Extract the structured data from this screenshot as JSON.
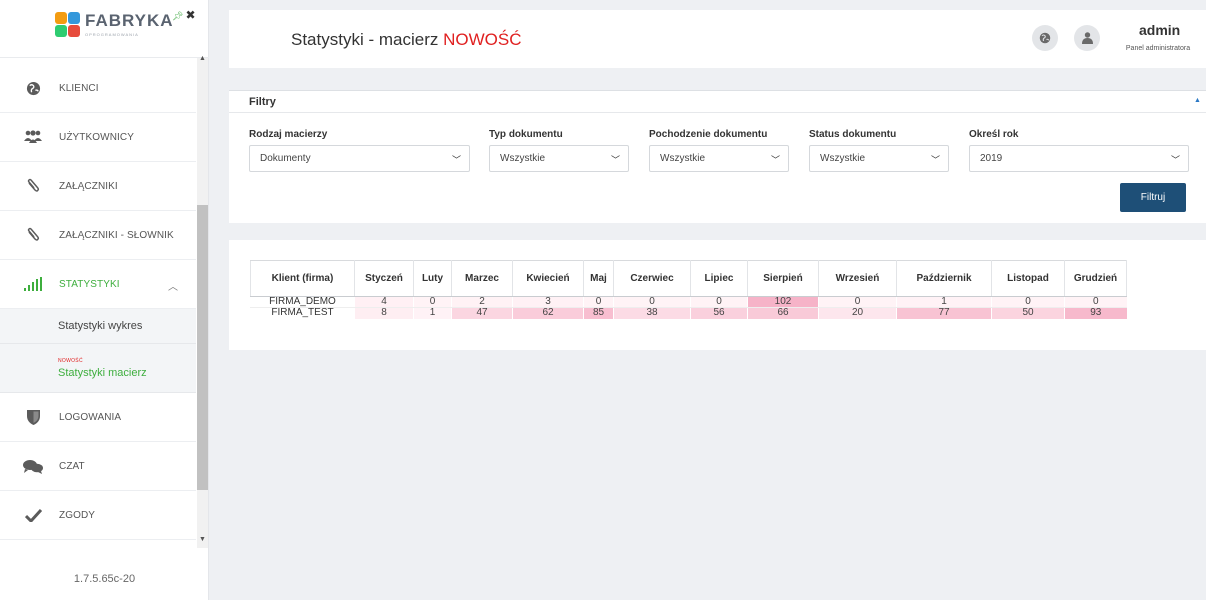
{
  "app": {
    "logo_text": "FABRYKA",
    "logo_sub": "OPROGRAMOWANIA",
    "version": "1.7.5.65c-20"
  },
  "sidebar": {
    "items": [
      {
        "label": "KLIENCI",
        "icon": "globe-icon"
      },
      {
        "label": "UŻYTKOWNICY",
        "icon": "users-icon"
      },
      {
        "label": "ZAŁĄCZNIKI",
        "icon": "paperclip-icon"
      },
      {
        "label": "ZAŁĄCZNIKI - SŁOWNIK",
        "icon": "paperclip-icon"
      },
      {
        "label": "STATYSTYKI",
        "icon": "bar-chart-icon",
        "active": true
      },
      {
        "label": "LOGOWANIA",
        "icon": "shield-icon"
      },
      {
        "label": "CZAT",
        "icon": "chat-icon"
      },
      {
        "label": "ZGODY",
        "icon": "check-icon"
      }
    ],
    "submenu": [
      {
        "label": "Statystyki wykres"
      },
      {
        "label": "Statystyki macierz",
        "badge": "NOWOŚĆ",
        "active": true
      }
    ]
  },
  "header": {
    "title": "Statystyki - macierz",
    "title_accent": "NOWOŚĆ",
    "user_name": "admin",
    "user_role": "Panel administratora"
  },
  "filters": {
    "title": "Filtry",
    "fields": [
      {
        "label": "Rodzaj macierzy",
        "value": "Dokumenty"
      },
      {
        "label": "Typ dokumentu",
        "value": "Wszystkie"
      },
      {
        "label": "Pochodzenie dokumentu",
        "value": "Wszystkie"
      },
      {
        "label": "Status dokumentu",
        "value": "Wszystkie"
      },
      {
        "label": "Określ rok",
        "value": "2019"
      }
    ],
    "button_label": "Filtruj"
  },
  "matrix": {
    "columns": [
      "Klient (firma)",
      "Styczeń",
      "Luty",
      "Marzec",
      "Kwiecień",
      "Maj",
      "Czerwiec",
      "Lipiec",
      "Sierpień",
      "Wrzesień",
      "Październik",
      "Listopad",
      "Grudzień"
    ],
    "rows": [
      {
        "client": "FIRMA_DEMO",
        "values": [
          "4",
          "0",
          "2",
          "3",
          "0",
          "0",
          "0",
          "102",
          "0",
          "1",
          "0",
          "0"
        ]
      },
      {
        "client": "FIRMA_TEST",
        "values": [
          "8",
          "1",
          "47",
          "62",
          "85",
          "38",
          "56",
          "66",
          "20",
          "77",
          "50",
          "93"
        ]
      }
    ],
    "heat_max": 102,
    "heat_color_low": "#fff3f6",
    "heat_color_high": "#f6b3c8"
  }
}
